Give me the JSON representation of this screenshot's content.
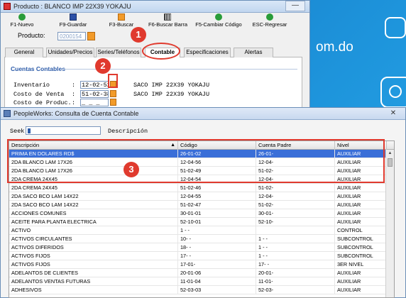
{
  "desktop": {
    "text": "om.do"
  },
  "product_window": {
    "title": "Producto : BLANCO IMP 22X39 YOKAJU",
    "minimize_label": "—",
    "toolbar": [
      {
        "label": "F1-Nuevo",
        "icon": "new-icon"
      },
      {
        "label": "F9-Guardar",
        "icon": "save-icon"
      },
      {
        "label": "F3-Buscar",
        "icon": "search-icon"
      },
      {
        "label": "F6-Buscar Barra",
        "icon": "barcode-icon"
      },
      {
        "label": "F5-Cambiar Código",
        "icon": "change-code-icon"
      },
      {
        "label": "ESC-Regresar",
        "icon": "back-icon"
      }
    ],
    "product_label": "Producto:",
    "product_value": "0200154",
    "tabs": [
      "General",
      "Unidades/Precios",
      "Series/Teléfonos",
      "Contable",
      "Especificaciones",
      "Alertas"
    ],
    "active_tab": "Contable",
    "section_title": "Cuentas Contables",
    "fields": [
      {
        "label": "Inventario",
        "value": "12-02-52",
        "desc": "SACO IMP 22X39 YOKAJU"
      },
      {
        "label": "Costo de Venta",
        "value": "51-02-38",
        "desc": "SACO IMP 22X39 YOKAJU"
      },
      {
        "label": "Costo de Produc.",
        "value": "_ _ _",
        "desc": ""
      }
    ]
  },
  "annotations": {
    "one": "1",
    "two": "2",
    "three": "3"
  },
  "consult_window": {
    "title": "PeopleWorks: Consulta de Cuenta Contable",
    "close_label": "✕",
    "seek_label": "Seek",
    "seek_value": "",
    "seek_desc": "Descripción",
    "columns": [
      "Descripción",
      "Código",
      "Cuenta Padre",
      "Nivel"
    ],
    "rows": [
      [
        "PRIMA EN DOLARES RD$",
        "26-01-02",
        "26-01-",
        "AUXILIAR"
      ],
      [
        "2DA BLANCO LAM 17X26",
        "12-04-56",
        "12-04-",
        "AUXILIAR"
      ],
      [
        "2DA BLANCO LAM 17X26",
        "51-02-49",
        "51-02-",
        "AUXILIAR"
      ],
      [
        "2DA CREMA 24X45",
        "12-04-54",
        "12-04-",
        "AUXILIAR"
      ],
      [
        "2DA CREMA 24X45",
        "51-02-46",
        "51-02-",
        "AUXILIAR"
      ],
      [
        "2DA SACO BCO LAM 14X22",
        "12-04-55",
        "12-04-",
        "AUXILIAR"
      ],
      [
        "2DA SACO BCO LAM 14X22",
        "51-02-47",
        "51-02-",
        "AUXILIAR"
      ],
      [
        "ACCIONES COMUNES",
        "30-01-01",
        "30-01-",
        "AUXILIAR"
      ],
      [
        "ACEITE PARA PLANTA ELECTRICA",
        "52-10-01",
        "52-10-",
        "AUXILIAR"
      ],
      [
        "ACTIVO",
        "1 - -",
        "",
        "CONTROL"
      ],
      [
        "ACTIVOS CIRCULANTES",
        "10- -",
        "1 - -",
        "SUBCONTROL"
      ],
      [
        "ACTIVOS DIFERIDOS",
        "18- -",
        "1 - -",
        "SUBCONTROL"
      ],
      [
        "ACTIVOS FIJOS",
        "17- -",
        "1 - -",
        "SUBCONTROL"
      ],
      [
        "ACTIVOS FIJOS",
        "17-01-",
        "17- -",
        "3ER NIVEL"
      ],
      [
        "ADELANTOS DE CLIENTES",
        "20-01-06",
        "20-01-",
        "AUXILIAR"
      ],
      [
        "ADELANTOS VENTAS FUTURAS",
        "11-01-04",
        "11-01-",
        "AUXILIAR"
      ],
      [
        "ADHESIVOS",
        "52-03-03",
        "52-03-",
        "AUXILIAR"
      ]
    ],
    "selected_row": 0
  }
}
